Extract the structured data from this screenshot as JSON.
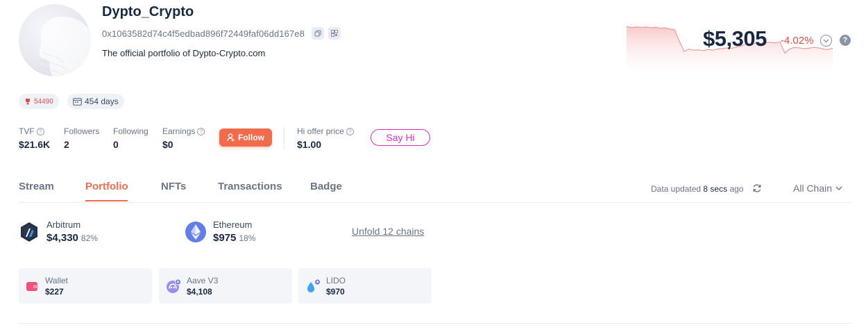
{
  "profile": {
    "username": "Dypto_Crypto",
    "address": "0x1063582d74c4f5edbad896f72449faf06dd167e8",
    "bio": "The official portfolio of Dypto-Crypto.com",
    "rank": "54490",
    "age": "454 days"
  },
  "value": {
    "total": "$5,305",
    "change": "-4.02%",
    "chart_data": {
      "type": "area",
      "series": [
        {
          "values": [
            0.86,
            0.83,
            0.85,
            0.84,
            0.85,
            0.83,
            0.84,
            0.82,
            0.83,
            0.8,
            0.78,
            0.5,
            0.24,
            0.3,
            0.27,
            0.28,
            0.26,
            0.29,
            0.27,
            0.3,
            0.31,
            0.33,
            0.32,
            0.35,
            0.38,
            0.43,
            0.42,
            0.45,
            0.44,
            0.46,
            0.47,
            0.45,
            0.48,
            0.2,
            0.3,
            0.34,
            0.33,
            0.31,
            0.32,
            0.34,
            0.33,
            0.3,
            0.29,
            0.32
          ]
        }
      ],
      "color": "#f08a8a"
    }
  },
  "stats": {
    "tvf_label": "TVF",
    "tvf_value": "$21.6K",
    "followers_label": "Followers",
    "followers_value": "2",
    "following_label": "Following",
    "following_value": "0",
    "earnings_label": "Earnings",
    "earnings_value": "$0",
    "follow_button": "Follow",
    "hi_offer_label": "Hi offer price",
    "hi_offer_value": "$1.00",
    "say_hi_button": "Say Hi"
  },
  "tabs": [
    "Stream",
    "Portfolio",
    "NFTs",
    "Transactions",
    "Badge"
  ],
  "active_tab": "Portfolio",
  "toolbar": {
    "updated_prefix": "Data updated",
    "updated_time": "8 secs",
    "updated_suffix": "ago",
    "chain_filter": "All Chain"
  },
  "chains": [
    {
      "name": "Arbitrum",
      "value": "$4,330",
      "percent": "82%"
    },
    {
      "name": "Ethereum",
      "value": "$975",
      "percent": "18%"
    }
  ],
  "unfold_label": "Unfold 12 chains",
  "protocols": [
    {
      "name": "Wallet",
      "value": "$227"
    },
    {
      "name": "Aave V3",
      "value": "$4,108"
    },
    {
      "name": "LIDO",
      "value": "$970"
    }
  ],
  "colors": {
    "accent": "#f26b4a",
    "negative": "#e34b4b",
    "say_hi": "#e229c9"
  }
}
